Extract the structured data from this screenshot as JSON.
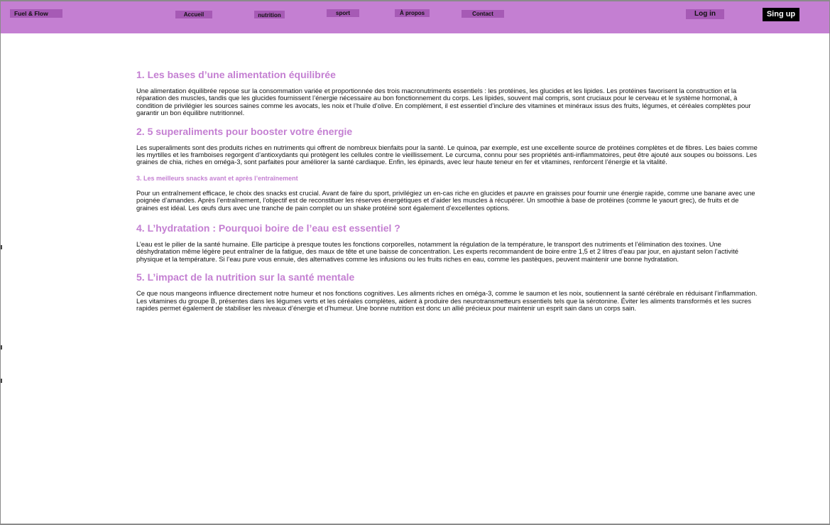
{
  "header": {
    "brand": "Fuel & Flow",
    "nav": [
      {
        "label": "Accueil"
      },
      {
        "label": "nutrition"
      },
      {
        "label": "sport"
      },
      {
        "label": "À propos"
      },
      {
        "label": "Contact"
      }
    ],
    "login_label": "Log in",
    "signup_label": "Sing up"
  },
  "sections": [
    {
      "title": "1. Les bases d’une alimentation équilibrée",
      "body": "Une alimentation équilibrée repose sur la consommation variée et proportionnée des trois macronutriments essentiels : les protéines, les glucides et les lipides. Les protéines favorisent la construction et la réparation des muscles, tandis que les glucides fournissent l’énergie nécessaire au bon fonctionnement du corps. Les lipides, souvent mal compris, sont cruciaux pour le cerveau et le système hormonal, à condition de privilégier les sources saines comme les avocats, les noix et l’huile d’olive. En complément, il est essentiel d’inclure des vitamines et minéraux issus des fruits, légumes, et céréales complètes pour garantir un bon équilibre nutritionnel."
    },
    {
      "title": "2. 5 superaliments pour booster votre énergie",
      "body": "Les superaliments sont des produits riches en nutriments qui offrent de nombreux bienfaits pour la santé. Le quinoa, par exemple, est une excellente source de protéines complètes et de fibres. Les baies comme les myrtilles et les framboises regorgent d’antioxydants qui protègent les cellules contre le vieillissement. Le curcuma, connu pour ses propriétés anti-inflammatoires, peut être ajouté aux soupes ou boissons. Les graines de chia, riches en oméga-3, sont parfaites pour améliorer la santé cardiaque. Enfin, les épinards, avec leur haute teneur en fer et vitamines, renforcent l’énergie et la vitalité."
    },
    {
      "title": "3. Les meilleurs snacks avant et après l’entraînement",
      "body": "Pour un entraînement efficace, le choix des snacks est crucial. Avant de faire du sport, privilégiez un en-cas riche en glucides et pauvre en graisses pour fournir une énergie rapide, comme une banane avec une poignée d’amandes. Après l’entraînement, l’objectif est de reconstituer les réserves énergétiques et d’aider les muscles à récupérer. Un smoothie à base de protéines (comme le yaourt grec), de fruits et de graines est idéal. Les œufs durs avec une tranche de pain complet ou un shake protéiné sont également d’excellentes options."
    },
    {
      "title": "4. L’hydratation : Pourquoi boire de l’eau est essentiel ?",
      "body": "L’eau est le pilier de la santé humaine. Elle participe à presque toutes les fonctions corporelles, notamment la régulation de la température, le transport des nutriments et l’élimination des toxines. Une déshydratation même légère peut entraîner de la fatigue, des maux de tête et une baisse de concentration. Les experts recommandent de boire entre 1,5 et 2 litres d’eau par jour, en ajustant selon l’activité physique et la température. Si l’eau pure vous ennuie, des alternatives comme les infusions ou les fruits riches en eau, comme les pastèques, peuvent maintenir une bonne hydratation."
    },
    {
      "title": "5. L’impact de la nutrition sur la santé mentale",
      "body": "Ce que nous mangeons influence directement notre humeur et nos fonctions cognitives. Les aliments riches en oméga-3, comme le saumon et les noix, soutiennent la santé cérébrale en réduisant l’inflammation. Les vitamines du groupe B, présentes dans les légumes verts et les céréales complètes, aident à produire des neurotransmetteurs essentiels tels que la sérotonine. Éviter les aliments transformés et les sucres rapides permet également de stabiliser les niveaux d’énergie et d’humeur. Une bonne nutrition est donc un allié précieux pour maintenir un esprit sain dans un corps sain."
    }
  ],
  "colors": {
    "header_bg": "#c47fd2",
    "nav_chip_bg": "#a65ab5",
    "heading": "#c47fd2",
    "signup_bg": "#000000"
  }
}
